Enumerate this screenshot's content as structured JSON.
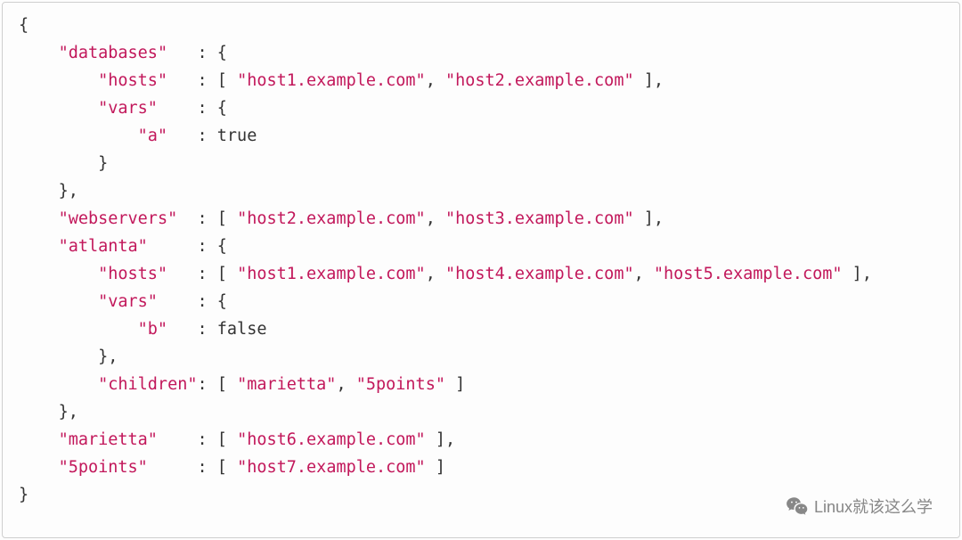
{
  "code": {
    "keys": {
      "databases": "\"databases\"",
      "hosts": "\"hosts\"",
      "vars": "\"vars\"",
      "a": "\"a\"",
      "webservers": "\"webservers\"",
      "atlanta": "\"atlanta\"",
      "b": "\"b\"",
      "children": "\"children\"",
      "marietta_key": "\"marietta\"",
      "fivepoints_key": "\"5points\""
    },
    "strings": {
      "host1": "\"host1.example.com\"",
      "host2": "\"host2.example.com\"",
      "host3": "\"host3.example.com\"",
      "host4": "\"host4.example.com\"",
      "host5": "\"host5.example.com\"",
      "host6": "\"host6.example.com\"",
      "host7": "\"host7.example.com\"",
      "marietta": "\"marietta\"",
      "fivepoints": "\"5points\""
    },
    "bools": {
      "true": "true",
      "false": "false"
    },
    "punct": {
      "lbrace": "{",
      "rbrace": "}",
      "rbrace_comma": "},",
      "lbracket": "[",
      "rbracket": "]",
      "rbracket_comma": "],",
      "colon": ":",
      "comma": ","
    }
  },
  "watermark": {
    "text": "Linux就该这么学"
  }
}
